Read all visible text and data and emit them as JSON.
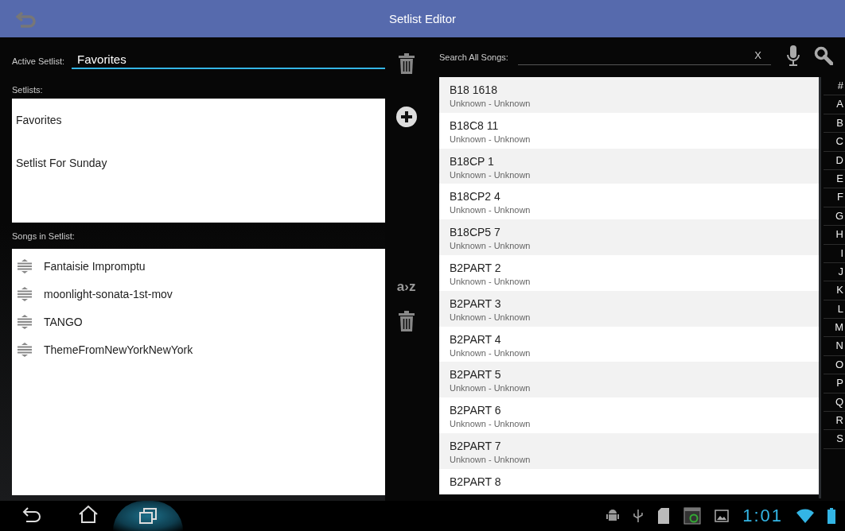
{
  "header": {
    "title": "Setlist Editor"
  },
  "active_setlist": {
    "label": "Active Setlist:",
    "value": "Favorites"
  },
  "setlists": {
    "label": "Setlists:",
    "items": [
      "Favorites",
      "Setlist For Sunday"
    ]
  },
  "songs_in_setlist": {
    "label": "Songs in Setlist:",
    "items": [
      "Fantaisie Impromptu",
      "moonlight-sonata-1st-mov",
      "TANGO",
      "ThemeFromNewYorkNewYork"
    ]
  },
  "sort_button": "a›z",
  "search": {
    "label": "Search All Songs:",
    "clear": "X"
  },
  "songs": [
    {
      "title": "B18 1618",
      "subtitle": "Unknown - Unknown"
    },
    {
      "title": "B18C8 11",
      "subtitle": "Unknown - Unknown"
    },
    {
      "title": "B18CP 1",
      "subtitle": "Unknown - Unknown"
    },
    {
      "title": "B18CP2 4",
      "subtitle": "Unknown - Unknown"
    },
    {
      "title": "B18CP5 7",
      "subtitle": "Unknown - Unknown"
    },
    {
      "title": "B2PART 2",
      "subtitle": "Unknown - Unknown"
    },
    {
      "title": "B2PART 3",
      "subtitle": "Unknown - Unknown"
    },
    {
      "title": "B2PART 4",
      "subtitle": "Unknown - Unknown"
    },
    {
      "title": "B2PART 5",
      "subtitle": "Unknown - Unknown"
    },
    {
      "title": "B2PART 6",
      "subtitle": "Unknown - Unknown"
    },
    {
      "title": "B2PART 7",
      "subtitle": "Unknown - Unknown"
    },
    {
      "title": "B2PART 8"
    }
  ],
  "index_letters": [
    "#",
    "A",
    "B",
    "C",
    "D",
    "E",
    "F",
    "G",
    "H",
    "I",
    "J",
    "K",
    "L",
    "M",
    "N",
    "O",
    "P",
    "Q",
    "R",
    "S"
  ],
  "status_bar": {
    "time": "1:01"
  }
}
